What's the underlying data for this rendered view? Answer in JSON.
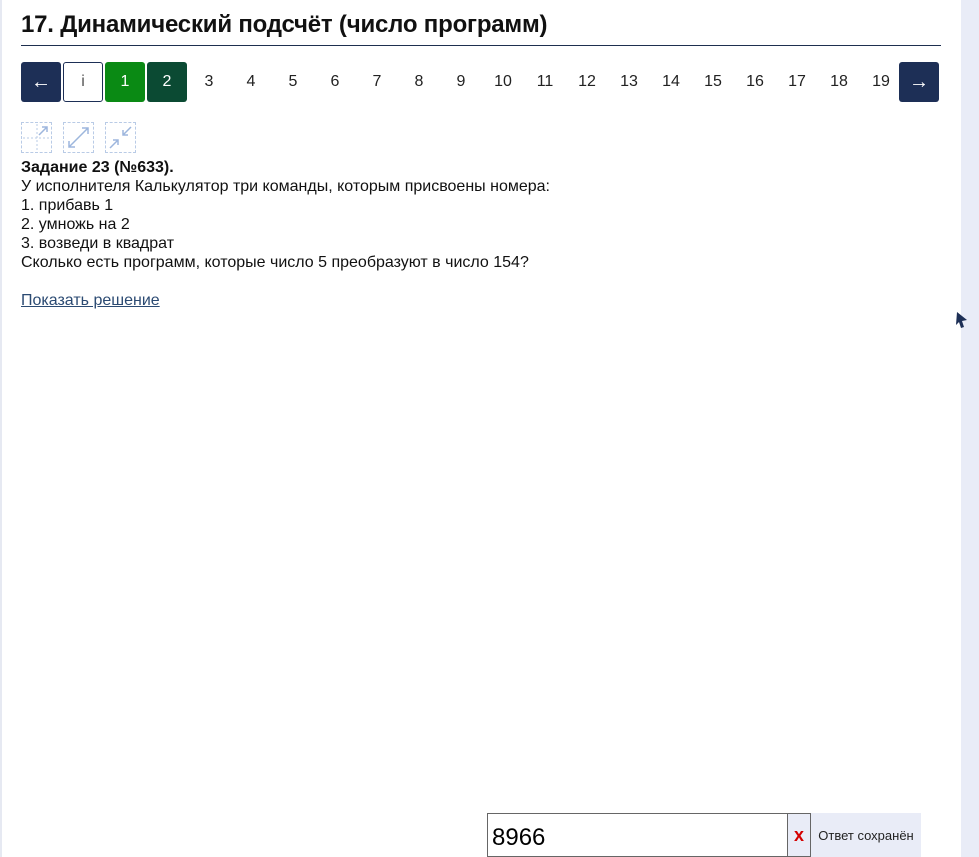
{
  "page": {
    "title": "17. Динамический подсчёт (число программ)"
  },
  "pager": {
    "prev_label": "←",
    "info_label": "i",
    "next_label": "→",
    "pages": [
      "1",
      "2",
      "3",
      "4",
      "5",
      "6",
      "7",
      "8",
      "9",
      "10",
      "11",
      "12",
      "13",
      "14",
      "15",
      "16",
      "17",
      "18",
      "19"
    ],
    "done_pages": [
      "1"
    ],
    "current_page": "2",
    "colors": {
      "arrow": "#1d2f56",
      "done": "#0a8a14",
      "current": "#0b4a33"
    }
  },
  "tools": {
    "icons": [
      "collapse-expand-icon",
      "expand-icon",
      "shrink-icon"
    ]
  },
  "task": {
    "heading": "Задание 23 (№633).",
    "lines": [
      "У исполнителя Калькулятор три команды, которым присвоены номера:",
      "1. прибавь 1",
      "2. умножь на 2",
      "3. возведи в квадрат",
      "Сколько есть программ, которые число 5 преобразуют в число 154?"
    ]
  },
  "solution_link": "Показать решение",
  "answer": {
    "value": "8966",
    "clear_label": "x",
    "status": "Ответ сохранён"
  }
}
